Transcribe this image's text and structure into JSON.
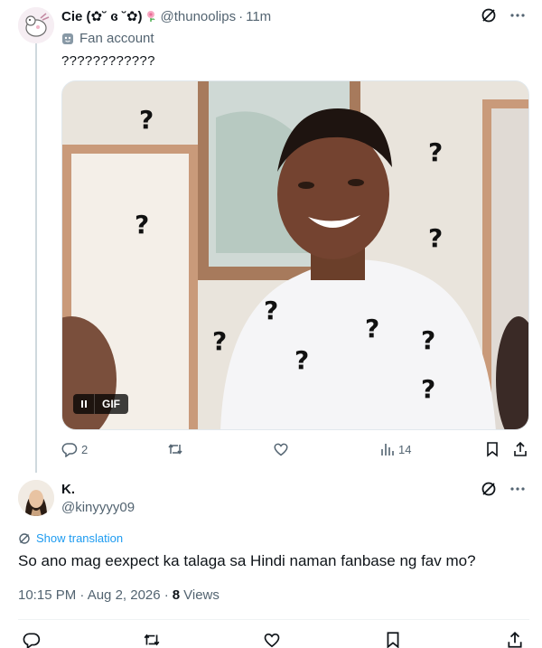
{
  "tweet": {
    "author_name": "Cie (✿˘ ɞ ˘✿)",
    "handle": "@thunoolips",
    "separator": "·",
    "time": "11m",
    "label": "Fan account",
    "text": "????????????",
    "media_badge": "GIF",
    "stats": {
      "replies": "2",
      "views": "14"
    }
  },
  "reply": {
    "author_name": "K.",
    "handle": "@kinyyyy09",
    "show_translation": "Show translation",
    "text": "So ano mag eexpect ka talaga sa Hindi naman fanbase ng fav mo?",
    "time": "10:15 PM · Aug 2, 2026 ·",
    "views_count": "8",
    "views_label": "Views"
  },
  "colors": {
    "accent": "#1d9bf0",
    "secondary_text": "#536471",
    "thread_line": "#cfd9de"
  },
  "icons": [
    "grok-icon",
    "more-icon",
    "reply-icon",
    "retweet-icon",
    "like-icon",
    "views-icon",
    "bookmark-icon",
    "share-icon",
    "pause-icon",
    "fan-account-icon",
    "translate-icon"
  ]
}
